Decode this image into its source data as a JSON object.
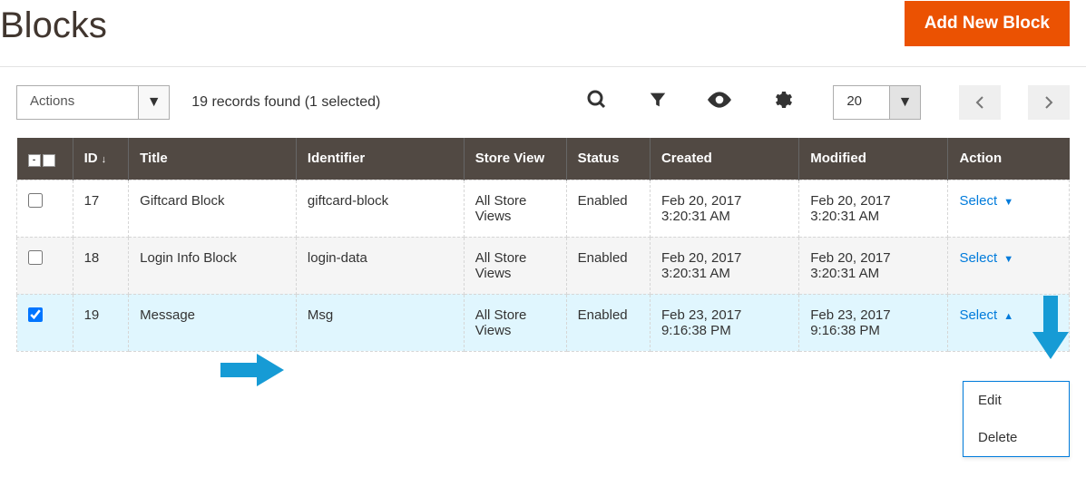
{
  "header": {
    "title": "Blocks",
    "add_button": "Add New Block"
  },
  "toolbar": {
    "actions_label": "Actions",
    "records_found": "19 records found (1 selected)",
    "per_page": "20"
  },
  "columns": {
    "id": "ID",
    "title": "Title",
    "identifier": "Identifier",
    "store_view": "Store View",
    "status": "Status",
    "created": "Created",
    "modified": "Modified",
    "action": "Action"
  },
  "rows": [
    {
      "checked": false,
      "id": "17",
      "title": "Giftcard Block",
      "identifier": "giftcard-block",
      "store_view": "All Store Views",
      "status": "Enabled",
      "created": "Feb 20, 2017 3:20:31 AM",
      "modified": "Feb 20, 2017 3:20:31 AM",
      "action": "Select"
    },
    {
      "checked": false,
      "id": "18",
      "title": "Login Info Block",
      "identifier": "login-data",
      "store_view": "All Store Views",
      "status": "Enabled",
      "created": "Feb 20, 2017 3:20:31 AM",
      "modified": "Feb 20, 2017 3:20:31 AM",
      "action": "Select"
    },
    {
      "checked": true,
      "id": "19",
      "title": "Message",
      "identifier": "Msg",
      "store_view": "All Store Views",
      "status": "Enabled",
      "created": "Feb 23, 2017 9:16:38 PM",
      "modified": "Feb 23, 2017 9:16:38 PM",
      "action": "Select"
    }
  ],
  "dropdown": {
    "edit": "Edit",
    "delete": "Delete"
  }
}
